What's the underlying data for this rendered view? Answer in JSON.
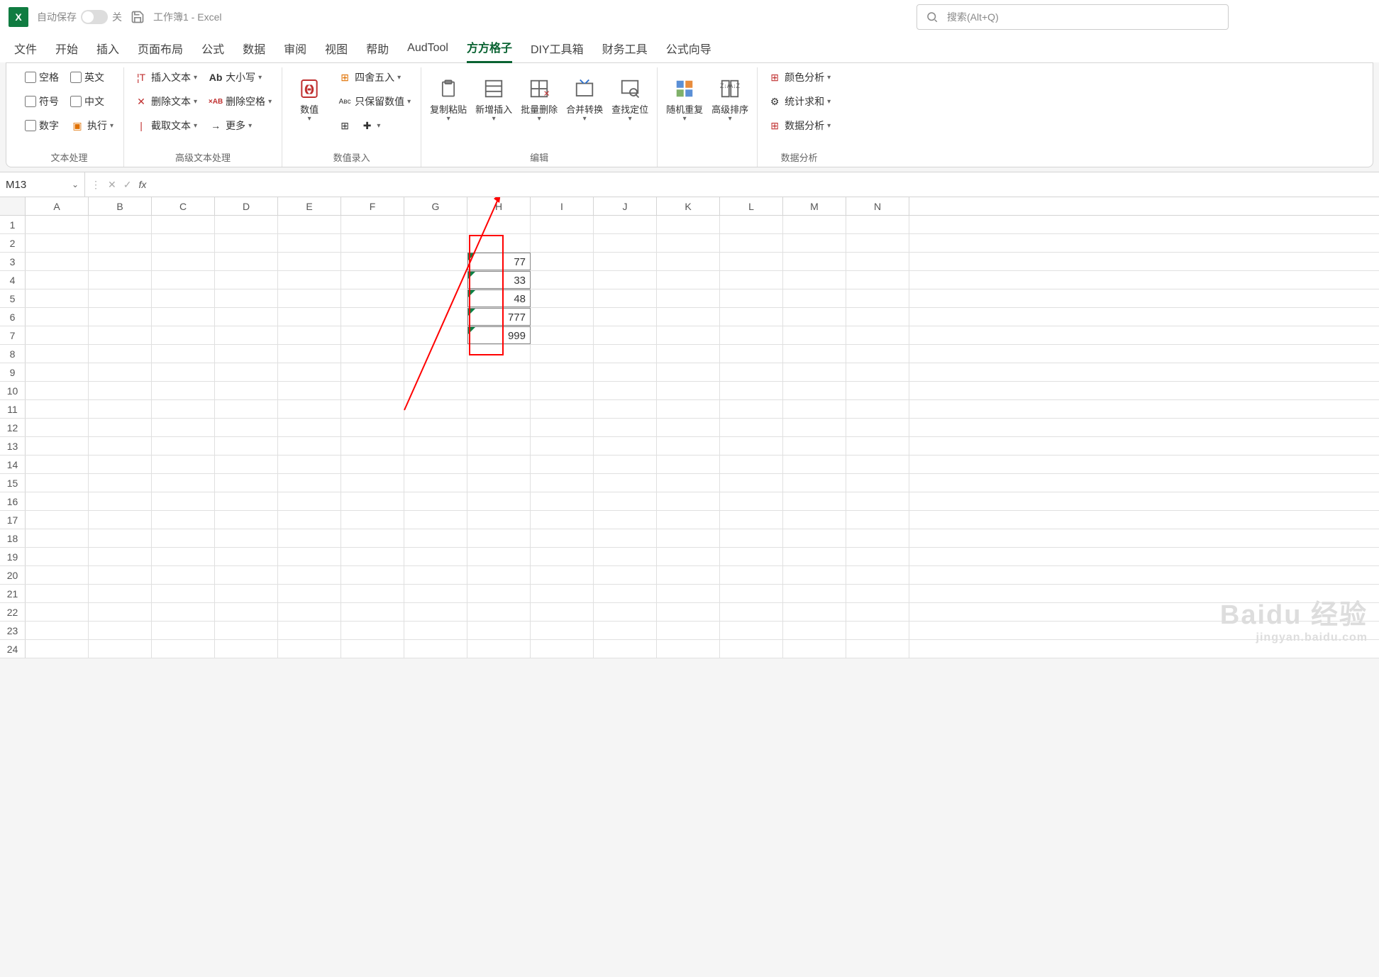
{
  "titlebar": {
    "app_icon": "X",
    "autosave_label": "自动保存",
    "autosave_off": "关",
    "doc_title": "工作簿1 - Excel",
    "search_placeholder": "搜索(Alt+Q)"
  },
  "tabs": [
    "文件",
    "开始",
    "插入",
    "页面布局",
    "公式",
    "数据",
    "审阅",
    "视图",
    "帮助",
    "AudTool",
    "方方格子",
    "DIY工具箱",
    "财务工具",
    "公式向导"
  ],
  "active_tab": "方方格子",
  "ribbon": {
    "text_process": {
      "blank": "空格",
      "english": "英文",
      "symbol": "符号",
      "chinese": "中文",
      "number": "数字",
      "execute": "执行",
      "title": "文本处理"
    },
    "adv_text": {
      "insert": "插入文本",
      "case": "大小写",
      "delete": "删除文本",
      "del_space": "删除空格",
      "trunc": "截取文本",
      "more": "更多",
      "title": "高级文本处理"
    },
    "value_entry": {
      "value": "数值",
      "round": "四舍五入",
      "keep_value": "只保留数值",
      "title": "数值录入"
    },
    "edit": {
      "copy_paste": "复制粘贴",
      "add_insert": "新增插入",
      "bulk_delete": "批量删除",
      "merge_swap": "合并转换",
      "find_locate": "查找定位",
      "title": "编辑"
    },
    "rand_sort": {
      "random": "随机重复",
      "adv_sort": "高级排序"
    },
    "analysis": {
      "color": "颜色分析",
      "stat": "统计求和",
      "data": "数据分析",
      "title": "数据分析"
    }
  },
  "formula_bar": {
    "name_box": "M13"
  },
  "columns": [
    "A",
    "B",
    "C",
    "D",
    "E",
    "F",
    "G",
    "H",
    "I",
    "J",
    "K",
    "L",
    "M",
    "N"
  ],
  "row_count": 24,
  "cells": {
    "H3": "77",
    "H4": "33",
    "H5": "48",
    "H6": "777",
    "H7": "999"
  },
  "watermark": {
    "main": "Baidu 经验",
    "sub": "jingyan.baidu.com"
  }
}
